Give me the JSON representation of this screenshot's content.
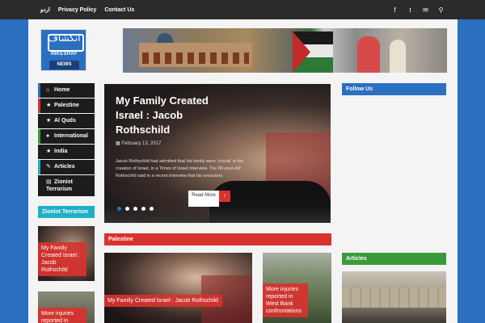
{
  "topbar": {
    "nav": [
      "اردو",
      "Privacy Policy",
      "Contact Us"
    ],
    "icons": [
      "facebook-icon",
      "twitter-icon",
      "email-icon",
      "search-icon"
    ]
  },
  "logo": {
    "mark": "انکشاف",
    "name": "INKESHAF",
    "tag": "NEWS"
  },
  "sidebar": {
    "items": [
      {
        "icon": "home-icon",
        "glyph": "⌂",
        "label": "Home",
        "accent": "#2a6fc0"
      },
      {
        "icon": "star-icon",
        "glyph": "★",
        "label": "Palestine",
        "accent": "#d8322e"
      },
      {
        "icon": "star-icon",
        "glyph": "★",
        "label": "Al Quds",
        "accent": "#1c1c1c"
      },
      {
        "icon": "globe-icon",
        "glyph": "●",
        "label": "International",
        "accent": "#3a9a3a"
      },
      {
        "icon": "star-icon",
        "glyph": "★",
        "label": "India",
        "accent": "#1c1c1c"
      },
      {
        "icon": "edit-icon",
        "glyph": "✎",
        "label": "Articles",
        "accent": "#1fb0c7"
      },
      {
        "icon": "document-icon",
        "glyph": "▤",
        "label": "Zionist Terrorism",
        "accent": "#1c1c1c"
      }
    ]
  },
  "featured": {
    "title": "My Family Created Israel : Jacob Rothschild",
    "date": "February 13, 2017",
    "excerpt": "Jacob Rothschild had admitted that his family were 'crucial' in the creation of Israel, in a Times of Israel interview.  The 80-year-old Rothschild said in a recent interview that his ancestors",
    "read_more": "Read More",
    "slides_total": 5,
    "active_slide": 1
  },
  "sections": {
    "follow": "Follow Us",
    "zionist": "Zionist Terrorism",
    "palestine": "Palestine",
    "articles": "Articles"
  },
  "zionist_posts": [
    {
      "title": "My Family Created Israel : Jacob Rothschild"
    },
    {
      "title": "More injuries reported in"
    }
  ],
  "palestine_posts": [
    {
      "title": "My Family Created Israel : Jacob Rothschild"
    },
    {
      "title": "More injuries reported in West Bank confrontations"
    }
  ],
  "colors": {
    "brand_blue": "#2a6fc0",
    "palestine_red": "#d8322e",
    "articles_green": "#3a9a3a",
    "zionist_cyan": "#1fb0c7",
    "topbar": "#2b2b2b"
  }
}
